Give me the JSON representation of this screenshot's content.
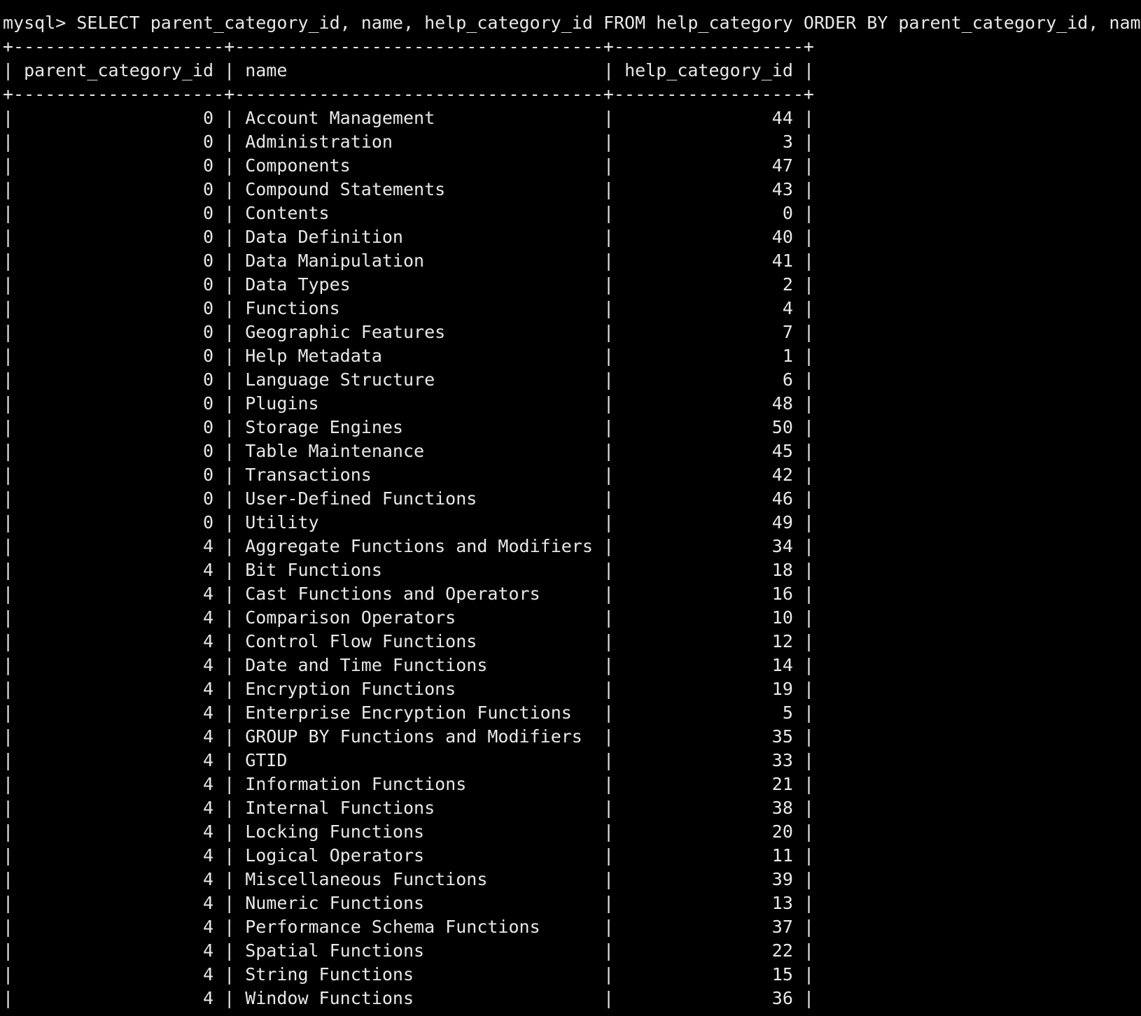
{
  "terminal": {
    "prompt": "mysql>",
    "command": "SELECT parent_category_id, name, help_category_id FROM help_category ORDER BY parent_category_id, name;"
  },
  "table": {
    "columns": [
      "parent_category_id",
      "name",
      "help_category_id"
    ],
    "rows": [
      [
        "0",
        "Account Management",
        "44"
      ],
      [
        "0",
        "Administration",
        "3"
      ],
      [
        "0",
        "Components",
        "47"
      ],
      [
        "0",
        "Compound Statements",
        "43"
      ],
      [
        "0",
        "Contents",
        "0"
      ],
      [
        "0",
        "Data Definition",
        "40"
      ],
      [
        "0",
        "Data Manipulation",
        "41"
      ],
      [
        "0",
        "Data Types",
        "2"
      ],
      [
        "0",
        "Functions",
        "4"
      ],
      [
        "0",
        "Geographic Features",
        "7"
      ],
      [
        "0",
        "Help Metadata",
        "1"
      ],
      [
        "0",
        "Language Structure",
        "6"
      ],
      [
        "0",
        "Plugins",
        "48"
      ],
      [
        "0",
        "Storage Engines",
        "50"
      ],
      [
        "0",
        "Table Maintenance",
        "45"
      ],
      [
        "0",
        "Transactions",
        "42"
      ],
      [
        "0",
        "User-Defined Functions",
        "46"
      ],
      [
        "0",
        "Utility",
        "49"
      ],
      [
        "4",
        "Aggregate Functions and Modifiers",
        "34"
      ],
      [
        "4",
        "Bit Functions",
        "18"
      ],
      [
        "4",
        "Cast Functions and Operators",
        "16"
      ],
      [
        "4",
        "Comparison Operators",
        "10"
      ],
      [
        "4",
        "Control Flow Functions",
        "12"
      ],
      [
        "4",
        "Date and Time Functions",
        "14"
      ],
      [
        "4",
        "Encryption Functions",
        "19"
      ],
      [
        "4",
        "Enterprise Encryption Functions",
        "5"
      ],
      [
        "4",
        "GROUP BY Functions and Modifiers",
        "35"
      ],
      [
        "4",
        "GTID",
        "33"
      ],
      [
        "4",
        "Information Functions",
        "21"
      ],
      [
        "4",
        "Internal Functions",
        "38"
      ],
      [
        "4",
        "Locking Functions",
        "20"
      ],
      [
        "4",
        "Logical Operators",
        "11"
      ],
      [
        "4",
        "Miscellaneous Functions",
        "39"
      ],
      [
        "4",
        "Numeric Functions",
        "13"
      ],
      [
        "4",
        "Performance Schema Functions",
        "37"
      ],
      [
        "4",
        "Spatial Functions",
        "22"
      ],
      [
        "4",
        "String Functions",
        "15"
      ],
      [
        "4",
        "Window Functions",
        "36"
      ]
    ]
  },
  "colors": {
    "background": "#000000",
    "foreground": "#e8e8e8"
  }
}
